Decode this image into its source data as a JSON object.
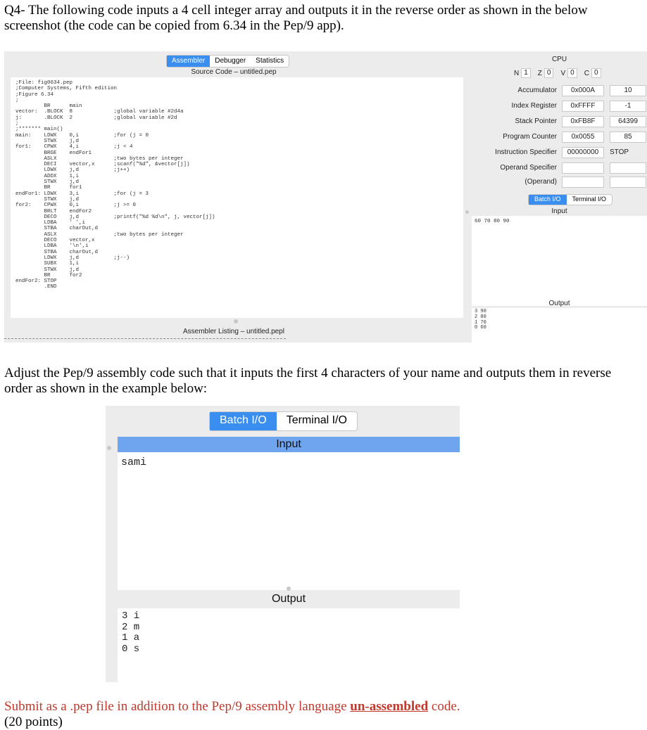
{
  "question": {
    "intro": "Q4- The following code inputs a 4 cell integer array and outputs it in the reverse order as shown in the below screenshot (the code can be copied from 6.34 in the Pep/9 app).",
    "task": "Adjust the Pep/9 assembly code such that it inputs the first 4 characters of your name and outputs them in reverse order as shown in the example below:",
    "submit_prefix": "Submit as a .pep file in addition to the Pep/9 assembly language ",
    "submit_emph": "un-assembled",
    "submit_suffix": " code.",
    "points": "(20 points)"
  },
  "pep_window": {
    "tabs": [
      "Assembler",
      "Debugger",
      "Statistics"
    ],
    "source_title": "Source Code – untitled.pep",
    "listing_title": "Assembler Listing – untitled.pepl",
    "code": ";File: fig0634.pep\n;Computer Systems, Fifth edition\n;Figure 6.34\n;\n         BR      main\nvector:  .BLOCK  8             ;global variable #2d4a\nj:       .BLOCK  2             ;global variable #2d\n;\n;******* main()\nmain:    LDWX    0,i           ;for (j = 0\n         STWX    j,d\nfor1:    CPWX    4,i           ;j < 4\n         BRGE    endFor1\n         ASLX                  ;two bytes per integer\n         DECI    vector,x      ;scanf(\"%d\", &vector[j])\n         LDWX    j,d           ;j++)\n         ADDX    1,i\n         STWX    j,d\n         BR      for1\nendFor1: LDWX    3,i           ;for (j = 3\n         STWX    j,d\nfor2:    CPWX    0,i           ;j >= 0\n         BRLT    endFor2\n         DECO    j,d           ;printf(\"%d %d\\n\", j, vector[j])\n         LDBA    ' ',i\n         STBA    charOut,d\n         ASLX                  ;two bytes per integer\n         DECO    vector,x\n         LDBA    '\\n',i\n         STBA    charOut,d\n         LDWX    j,d           ;j--)\n         SUBX    1,i\n         STWX    j,d\n         BR      for2\nendFor2: STOP\n         .END",
    "cpu": {
      "title": "CPU",
      "flags": [
        {
          "name": "N",
          "value": "1"
        },
        {
          "name": "Z",
          "value": "0"
        },
        {
          "name": "V",
          "value": "0"
        },
        {
          "name": "C",
          "value": "0"
        }
      ],
      "registers": [
        {
          "label": "Accumulator",
          "hex": "0x000A",
          "dec": "10"
        },
        {
          "label": "Index Register",
          "hex": "0xFFFF",
          "dec": "-1"
        },
        {
          "label": "Stack Pointer",
          "hex": "0xFB8F",
          "dec": "64399"
        },
        {
          "label": "Program Counter",
          "hex": "0x0055",
          "dec": "85"
        },
        {
          "label": "Instruction Specifier",
          "hex": "00000000",
          "dec": "STOP"
        },
        {
          "label": "Operand Specifier",
          "hex": "",
          "dec": ""
        },
        {
          "label": "(Operand)",
          "hex": "",
          "dec": ""
        }
      ]
    },
    "io": {
      "tabs": [
        "Batch I/O",
        "Terminal I/O"
      ],
      "input_label": "Input",
      "input_text": "60 70 80 90",
      "output_label": "Output",
      "output_text": "3 90\n2 80\n1 70\n0 60"
    }
  },
  "example_window": {
    "tabs": [
      "Batch I/O",
      "Terminal I/O"
    ],
    "input_label": "Input",
    "input_text": "sami",
    "output_label": "Output",
    "output_text": "3 i\n2 m\n1 a\n0 s"
  },
  "colors": {
    "tab_active": "#3a8ef0",
    "input_bar": "#6fa4ee",
    "submit_text": "#c0392b"
  }
}
